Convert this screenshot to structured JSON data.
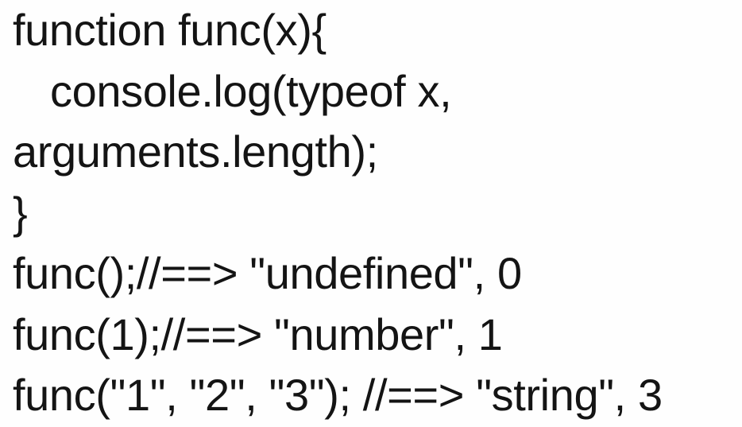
{
  "code": {
    "lines": [
      "function func(x){",
      "console.log(typeof x,",
      "arguments.length);",
      "}",
      "func();//==> \"undefined\", 0",
      "func(1);//==> \"number\", 1",
      "func(\"1\", \"2\", \"3\"); //==> \"string\", 3"
    ]
  },
  "colors": {
    "text": "#141414",
    "background": "#fefefe"
  }
}
